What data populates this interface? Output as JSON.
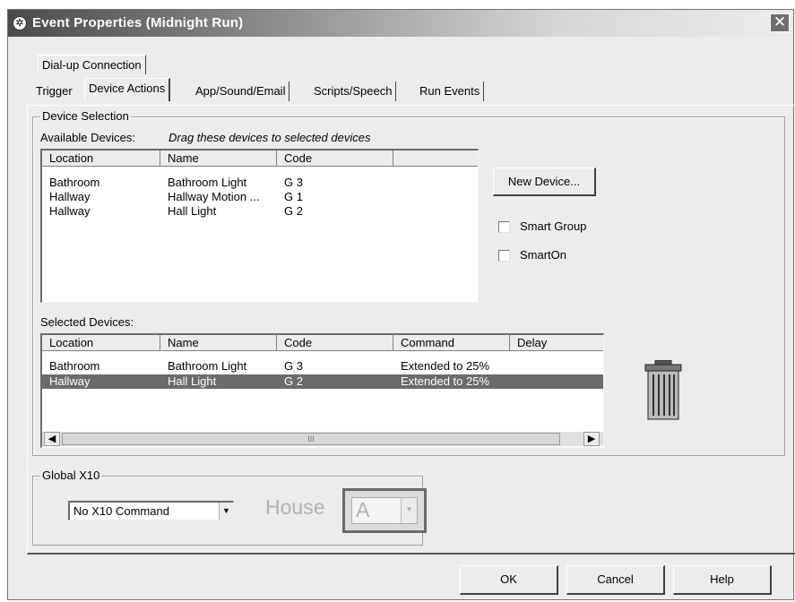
{
  "window": {
    "title": "Event Properties (Midnight Run)",
    "close_glyph": "✕"
  },
  "tabs": {
    "row_top": [
      "Dial-up Connection"
    ],
    "row_bottom": [
      "Trigger",
      "Device Actions",
      "App/Sound/Email",
      "Scripts/Speech",
      "Run Events"
    ],
    "active": "Device Actions"
  },
  "device_selection": {
    "group_label": "Device Selection",
    "available_label": "Available Devices:",
    "drag_hint": "Drag these devices to selected devices",
    "available_columns": [
      "Location",
      "Name",
      "Code",
      ""
    ],
    "available_rows": [
      [
        "Bathroom",
        "Bathroom Light",
        "G 3"
      ],
      [
        "Hallway",
        "Hallway Motion ...",
        "G 1"
      ],
      [
        "Hallway",
        "Hall Light",
        "G 2"
      ]
    ],
    "new_device_button": "New Device...",
    "smart_group_label": "Smart Group",
    "smarton_label": "SmartOn",
    "selected_label": "Selected Devices:",
    "selected_columns": [
      "Location",
      "Name",
      "Code",
      "Command",
      "Delay"
    ],
    "selected_rows": [
      [
        "Bathroom",
        "Bathroom Light",
        "G 3",
        "Extended to  25%",
        ""
      ],
      [
        "Hallway",
        "Hall Light",
        "G 2",
        "Extended to  25%",
        ""
      ]
    ],
    "selected_row_index": 1,
    "scroll_left": "◀",
    "scroll_right": "▶",
    "scroll_thumb": "III"
  },
  "global_x10": {
    "group_label": "Global X10",
    "command_value": "No X10 Command",
    "house_label": "House",
    "house_value": "A",
    "dropdown_glyph": "▼"
  },
  "footer": {
    "ok": "OK",
    "cancel": "Cancel",
    "help": "Help"
  },
  "icons": [
    "app-icon",
    "close-icon",
    "trash-icon",
    "chevron-down-icon"
  ],
  "colors": {
    "selection": "#6b6b6b",
    "dialog_bg": "#ececec"
  }
}
